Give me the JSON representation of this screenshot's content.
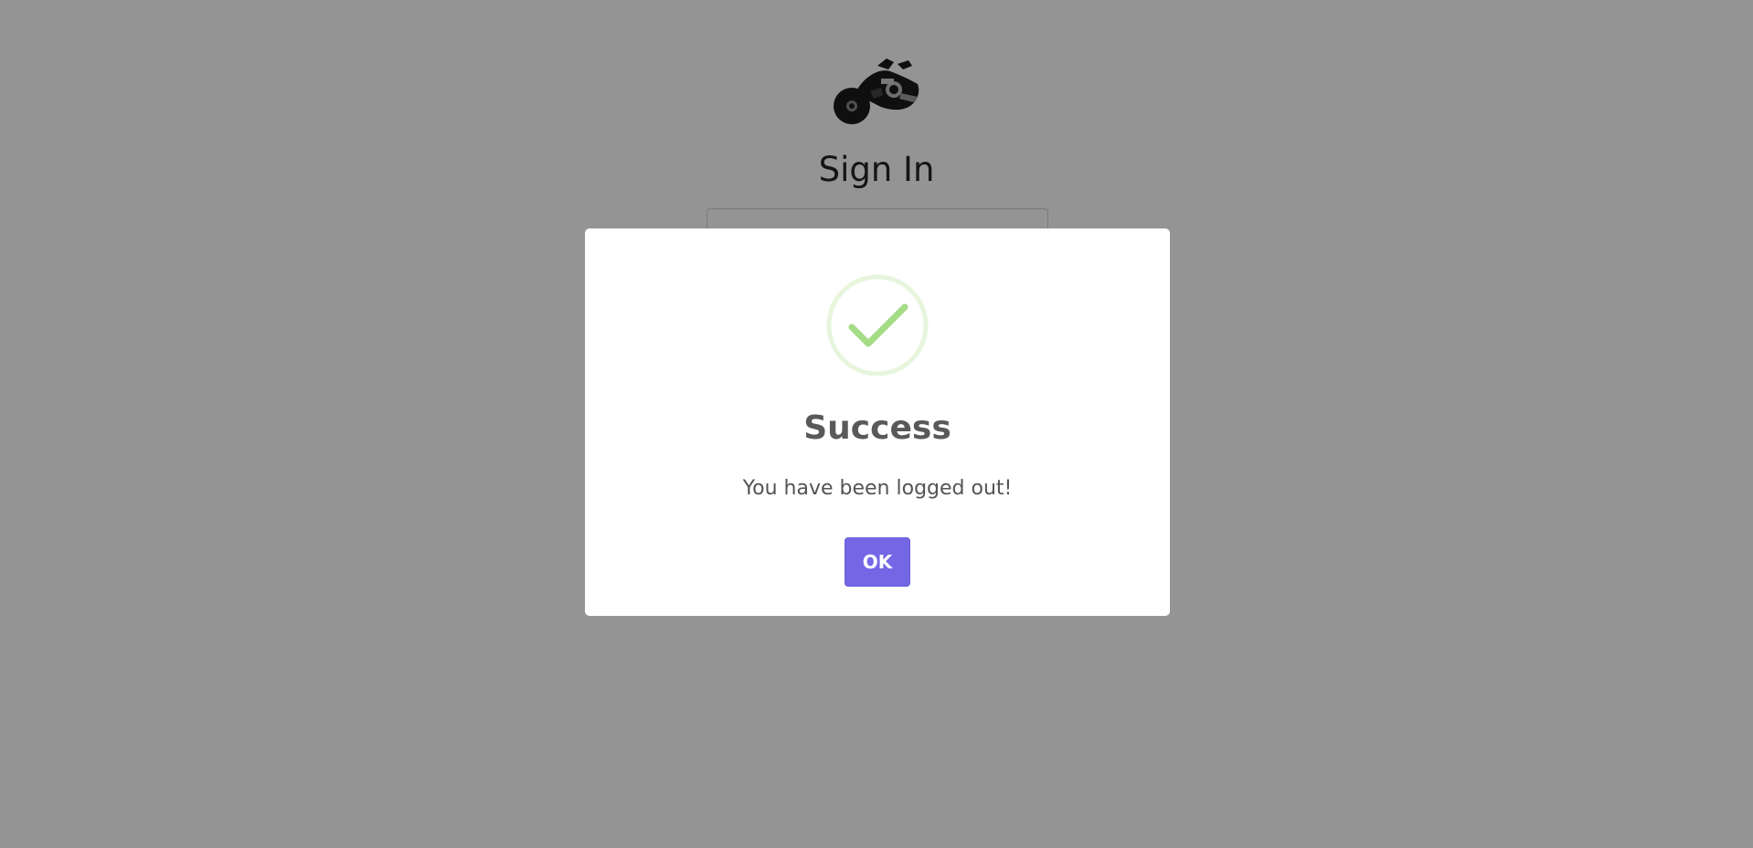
{
  "page": {
    "title": "Sign In",
    "logo_icon": "motorcycle-logo"
  },
  "dialog": {
    "icon": "success-check-icon",
    "title": "Success",
    "message": "You have been logged out!",
    "ok_label": "OK",
    "colors": {
      "check": "#a5dc86",
      "check_ring": "#e8f5dd",
      "button": "#7367e6"
    }
  }
}
